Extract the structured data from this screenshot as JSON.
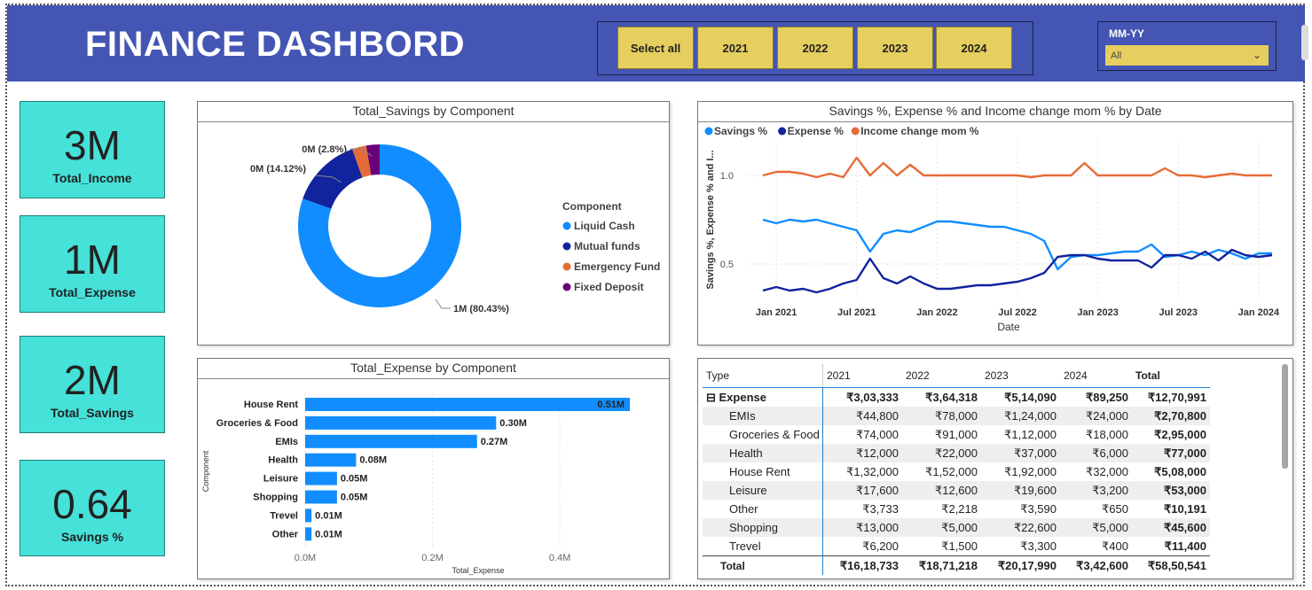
{
  "header": {
    "title": "FINANCE DASHBORD",
    "years": [
      "Select all",
      "2021",
      "2022",
      "2023",
      "2024"
    ],
    "mmyy_label": "MM-YY",
    "mmyy_value": "All"
  },
  "kpis": [
    {
      "value": "3M",
      "label": "Total_Income"
    },
    {
      "value": "1M",
      "label": "Total_Expense"
    },
    {
      "value": "2M",
      "label": "Total_Savings"
    },
    {
      "value": "0.64",
      "label": "Savings %"
    }
  ],
  "donut": {
    "title": "Total_Savings by Component",
    "legend_title": "Component",
    "label_liquid": "1M (80.43%)",
    "label_mutual": "0M (14.12%)",
    "label_emergency": "0M (2.8%)"
  },
  "line": {
    "title": "Savings %, Expense % and Income change mom % by Date",
    "legend": [
      "Savings %",
      "Expense %",
      "Income change mom %"
    ],
    "ylabel": "Savings %, Expense % and I...",
    "xlabel": "Date",
    "yticks": [
      "1.0",
      "0.5"
    ],
    "xticks": [
      "Jan 2021",
      "Jul 2021",
      "Jan 2022",
      "Jul 2022",
      "Jan 2023",
      "Jul 2023",
      "Jan 2024"
    ]
  },
  "bar": {
    "title": "Total_Expense by Component",
    "ylabel": "Component",
    "xlabel": "Total_Expense",
    "xticks": [
      "0.0M",
      "0.2M",
      "0.4M"
    ]
  },
  "matrix": {
    "headers": [
      "Type",
      "2021",
      "2022",
      "2023",
      "2024",
      "Total"
    ],
    "group": {
      "name": "Expense",
      "values": [
        "₹3,03,333",
        "₹3,64,318",
        "₹5,14,090",
        "₹89,250",
        "₹12,70,991"
      ]
    },
    "rows": [
      {
        "name": "EMIs",
        "values": [
          "₹44,800",
          "₹78,000",
          "₹1,24,000",
          "₹24,000",
          "₹2,70,800"
        ]
      },
      {
        "name": "Groceries & Food",
        "values": [
          "₹74,000",
          "₹91,000",
          "₹1,12,000",
          "₹18,000",
          "₹2,95,000"
        ]
      },
      {
        "name": "Health",
        "values": [
          "₹12,000",
          "₹22,000",
          "₹37,000",
          "₹6,000",
          "₹77,000"
        ]
      },
      {
        "name": "House Rent",
        "values": [
          "₹1,32,000",
          "₹1,52,000",
          "₹1,92,000",
          "₹32,000",
          "₹5,08,000"
        ]
      },
      {
        "name": "Leisure",
        "values": [
          "₹17,600",
          "₹12,600",
          "₹19,600",
          "₹3,200",
          "₹53,000"
        ]
      },
      {
        "name": "Other",
        "values": [
          "₹3,733",
          "₹2,218",
          "₹3,590",
          "₹650",
          "₹10,191"
        ]
      },
      {
        "name": "Shopping",
        "values": [
          "₹13,000",
          "₹5,000",
          "₹22,600",
          "₹5,000",
          "₹45,600"
        ]
      },
      {
        "name": "Trevel",
        "values": [
          "₹6,200",
          "₹1,500",
          "₹3,300",
          "₹400",
          "₹11,400"
        ]
      }
    ],
    "total": {
      "name": "Total",
      "values": [
        "₹16,18,733",
        "₹18,71,218",
        "₹20,17,990",
        "₹3,42,600",
        "₹58,50,541"
      ]
    }
  },
  "colors": {
    "header_bg": "#4455b3",
    "kpi_bg": "#46e1d9",
    "button_bg": "#e6cf5f",
    "liquid": "#118dff",
    "mutual": "#12239e",
    "emergency": "#e66c37",
    "fixed": "#6b007b",
    "bar": "#118dff"
  },
  "chart_data": [
    {
      "type": "pie",
      "title": "Total_Savings by Component",
      "legend_title": "Component",
      "categories": [
        "Liquid Cash",
        "Mutual funds",
        "Emergency Fund",
        "Fixed Deposit"
      ],
      "values": [
        80.43,
        14.12,
        2.8,
        2.65
      ],
      "legend_position": "right"
    },
    {
      "type": "line",
      "title": "Savings %, Expense % and Income change mom % by Date",
      "xlabel": "Date",
      "ylabel": "Savings %, Expense % and I...",
      "x": [
        "2020-12",
        "2021-01",
        "2021-02",
        "2021-03",
        "2021-04",
        "2021-05",
        "2021-06",
        "2021-07",
        "2021-08",
        "2021-09",
        "2021-10",
        "2021-11",
        "2021-12",
        "2022-01",
        "2022-02",
        "2022-03",
        "2022-04",
        "2022-05",
        "2022-06",
        "2022-07",
        "2022-08",
        "2022-09",
        "2022-10",
        "2022-11",
        "2022-12",
        "2023-01",
        "2023-02",
        "2023-03",
        "2023-04",
        "2023-05",
        "2023-06",
        "2023-07",
        "2023-08",
        "2023-09",
        "2023-10",
        "2023-11",
        "2023-12",
        "2024-01",
        "2024-02"
      ],
      "series": [
        {
          "name": "Savings %",
          "values": [
            0.75,
            0.73,
            0.75,
            0.74,
            0.75,
            0.73,
            0.71,
            0.69,
            0.57,
            0.67,
            0.69,
            0.68,
            0.71,
            0.74,
            0.74,
            0.73,
            0.72,
            0.71,
            0.71,
            0.69,
            0.67,
            0.63,
            0.47,
            0.54,
            0.55,
            0.55,
            0.56,
            0.57,
            0.57,
            0.61,
            0.54,
            0.55,
            0.57,
            0.55,
            0.58,
            0.56,
            0.53,
            0.56,
            0.56
          ]
        },
        {
          "name": "Expense %",
          "values": [
            0.35,
            0.37,
            0.35,
            0.36,
            0.34,
            0.36,
            0.39,
            0.41,
            0.53,
            0.42,
            0.39,
            0.43,
            0.39,
            0.36,
            0.36,
            0.37,
            0.38,
            0.38,
            0.39,
            0.4,
            0.42,
            0.45,
            0.54,
            0.55,
            0.55,
            0.53,
            0.52,
            0.52,
            0.52,
            0.48,
            0.55,
            0.55,
            0.53,
            0.57,
            0.52,
            0.58,
            0.55,
            0.54,
            0.55
          ]
        },
        {
          "name": "Income change mom %",
          "values": [
            1.0,
            1.02,
            1.02,
            1.01,
            0.99,
            1.01,
            0.99,
            1.1,
            1.0,
            1.07,
            1.0,
            1.06,
            1.0,
            1.0,
            1.0,
            1.0,
            1.0,
            1.0,
            1.0,
            1.0,
            0.99,
            1.0,
            1.0,
            1.0,
            1.07,
            1.0,
            1.0,
            1.0,
            1.0,
            1.0,
            1.04,
            1.0,
            1.0,
            0.99,
            1.0,
            1.01,
            1.0,
            1.0,
            1.0
          ]
        }
      ],
      "ylim": [
        0.3,
        1.2
      ],
      "legend_position": "top-left",
      "grid": true
    },
    {
      "type": "bar",
      "orientation": "horizontal",
      "title": "Total_Expense by Component",
      "xlabel": "Total_Expense",
      "ylabel": "Component",
      "categories": [
        "House Rent",
        "Groceries & Food",
        "EMIs",
        "Health",
        "Leisure",
        "Shopping",
        "Trevel",
        "Other"
      ],
      "values": [
        0.51,
        0.3,
        0.27,
        0.08,
        0.05,
        0.05,
        0.01,
        0.01
      ],
      "value_labels": [
        "0.51M",
        "0.30M",
        "0.27M",
        "0.08M",
        "0.05M",
        "0.05M",
        "0.01M",
        "0.01M"
      ],
      "xlim": [
        0,
        0.51
      ],
      "grid": true
    }
  ]
}
